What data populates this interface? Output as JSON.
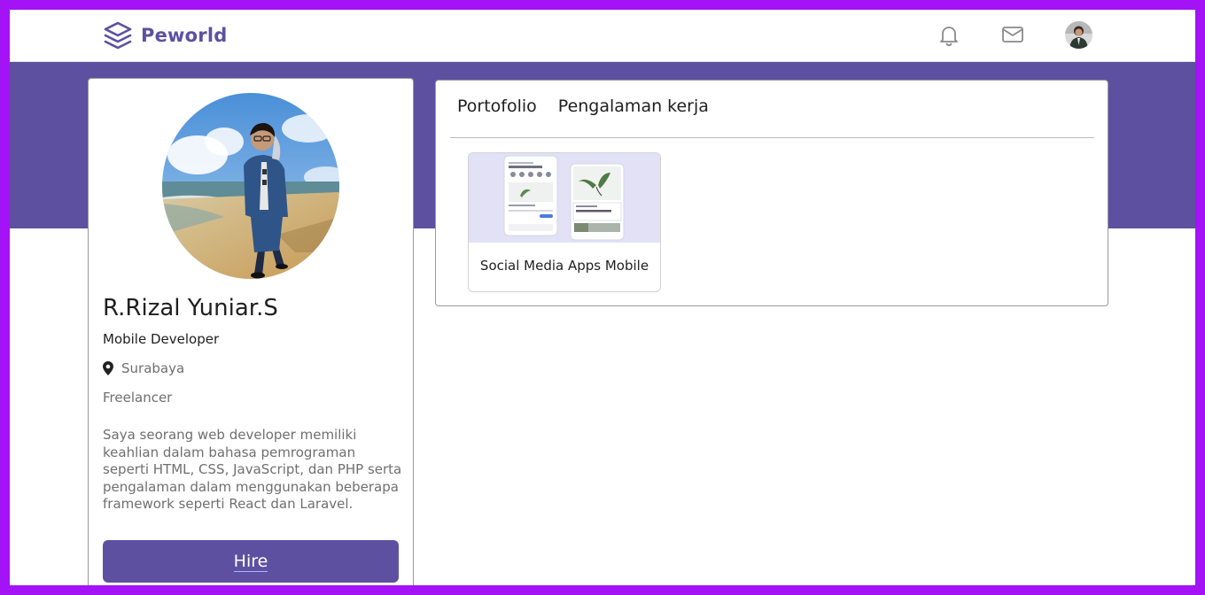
{
  "navbar": {
    "brand": "Peworld",
    "icons": [
      "layers-logo-icon",
      "bell-icon",
      "mail-icon",
      "user-avatar"
    ]
  },
  "profile": {
    "name": "R.Rizal Yuniar.S",
    "job_title": "Mobile Developer",
    "location": "Surabaya",
    "status": "Freelancer",
    "bio": "Saya seorang web developer memiliki keahlian dalam bahasa pemrograman seperti HTML, CSS, JavaScript, dan PHP serta pengalaman dalam menggunakan beberapa framework seperti React dan Laravel.",
    "hire_label": "Hire"
  },
  "tabs": [
    "Portofolio",
    "Pengalaman kerja"
  ],
  "portfolio": [
    {
      "title": "Social Media Apps Mobile"
    }
  ],
  "colors": {
    "primary": "#5e50a1",
    "frame": "#a313f5",
    "text": "#1f1f1f",
    "muted": "#6f6f6f"
  }
}
